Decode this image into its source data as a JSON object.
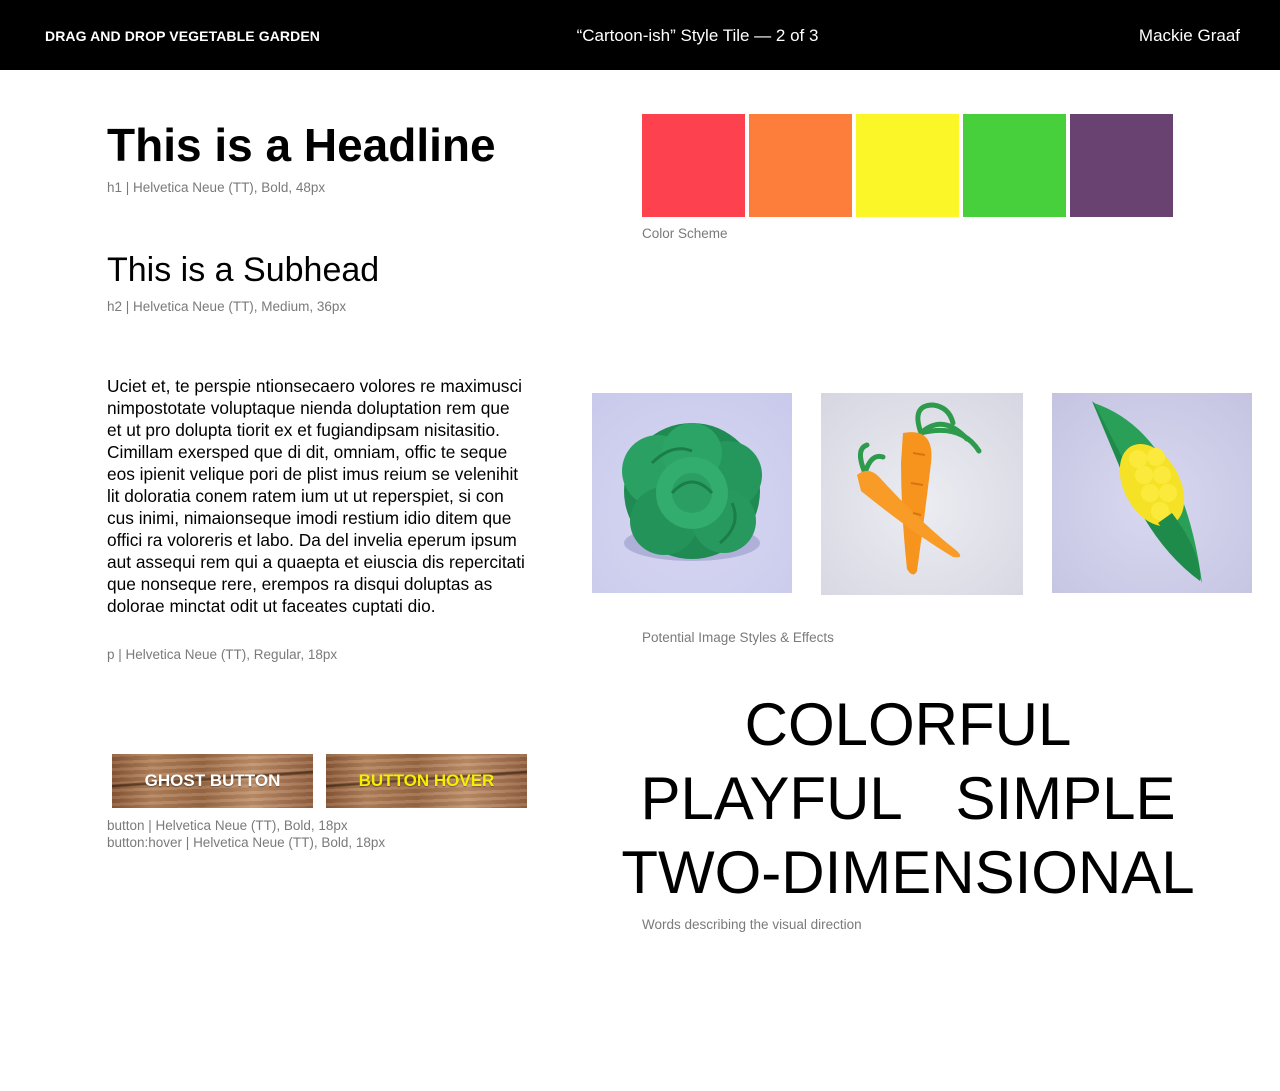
{
  "header": {
    "project": "DRAG AND DROP VEGETABLE GARDEN",
    "tile": "“Cartoon-ish” Style Tile — 2 of 3",
    "author": "Mackie Graaf"
  },
  "typography": {
    "h1_text": "This is a Headline",
    "h1_caption": "h1 | Helvetica Neue (TT), Bold, 48px",
    "h2_text": "This is a Subhead",
    "h2_caption": "h2 | Helvetica Neue (TT), Medium, 36px",
    "p_text": "Uciet et, te perspie ntionsecaero volores re maximusci nimpostotate voluptaque nienda doluptation rem que et ut pro dolupta tiorit ex et fugiandipsam nisitasitio. Cimillam exersped que di dit, omniam, offic te seque eos ipienit velique pori de plist imus reium se velenihit lit doloratia conem ratem ium ut ut reperspiet, si con cus inimi, nimaionseque imodi restium idio ditem que offici ra voloreris et labo. Da del invelia eperum ipsum aut assequi rem qui a quaepta et eiuscia dis repercitati que nonseque rere, erempos ra disqui doluptas as dolorae minctat odit ut faceates cuptati dio.",
    "p_caption": "p | Helvetica Neue (TT), Regular, 18px"
  },
  "buttons": {
    "ghost_label": "GHOST BUTTON",
    "hover_label": "BUTTON HOVER",
    "caption_line1": "button | Helvetica Neue (TT), Bold, 18px",
    "caption_line2": "button:hover | Helvetica Neue (TT), Bold, 18px",
    "ghost_text_color": "#ffffff",
    "hover_text_color": "#f5f000"
  },
  "colors": {
    "swatches": [
      "#fd414f",
      "#fd7d3b",
      "#faf628",
      "#47d03c",
      "#6a4272"
    ],
    "caption": "Color Scheme"
  },
  "images": {
    "items": [
      "cabbage",
      "carrots",
      "corn"
    ],
    "caption": "Potential Image Styles & Effects"
  },
  "words": {
    "line1": [
      "COLORFUL"
    ],
    "line2": [
      "PLAYFUL",
      "SIMPLE"
    ],
    "line3": [
      "TWO-DIMENSIONAL"
    ],
    "caption": "Words describing the visual direction"
  }
}
